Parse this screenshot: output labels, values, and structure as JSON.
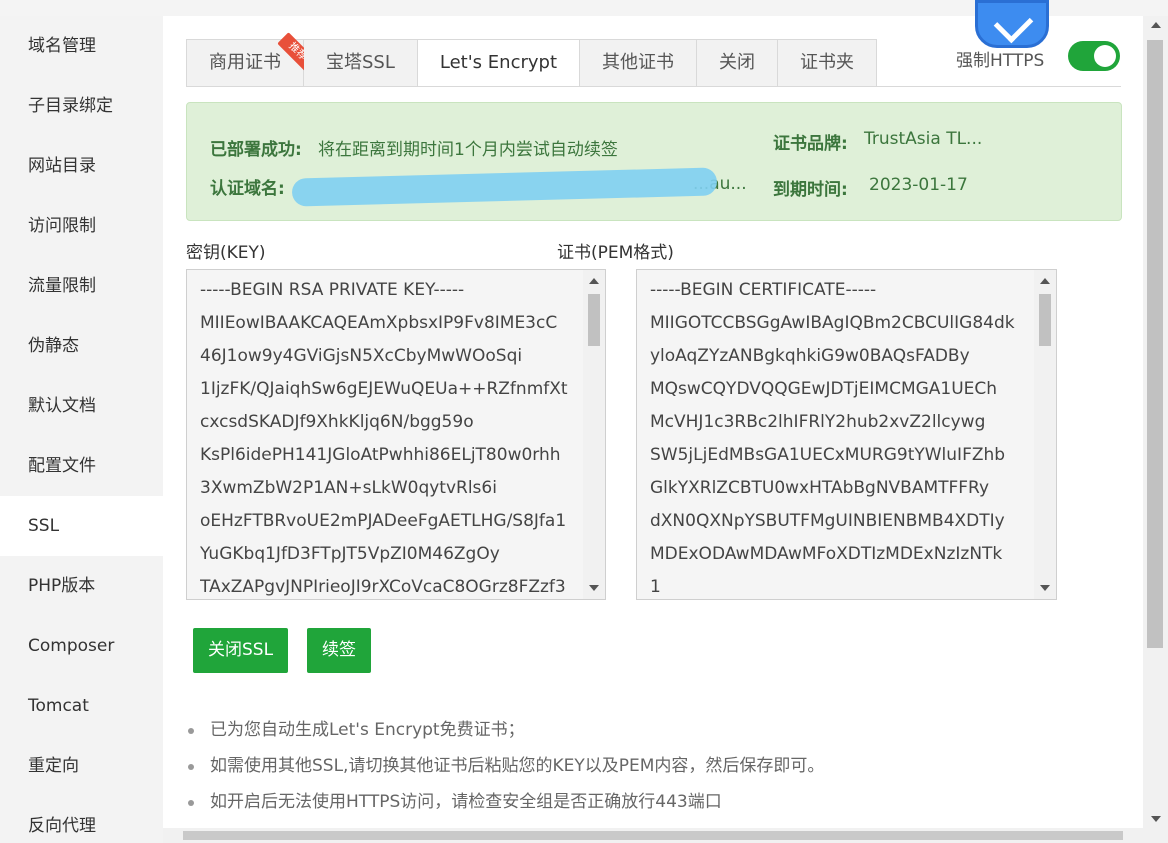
{
  "sidebar": {
    "items": [
      {
        "label": "域名管理"
      },
      {
        "label": "子目录绑定"
      },
      {
        "label": "网站目录"
      },
      {
        "label": "访问限制"
      },
      {
        "label": "流量限制"
      },
      {
        "label": "伪静态"
      },
      {
        "label": "默认文档"
      },
      {
        "label": "配置文件"
      },
      {
        "label": "SSL",
        "active": true
      },
      {
        "label": "PHP版本"
      },
      {
        "label": "Composer"
      },
      {
        "label": "Tomcat"
      },
      {
        "label": "重定向"
      },
      {
        "label": "反向代理"
      }
    ]
  },
  "tabs": [
    {
      "label": "商用证书",
      "badge": "推荐"
    },
    {
      "label": "宝塔SSL"
    },
    {
      "label": "Let's Encrypt",
      "active": true
    },
    {
      "label": "其他证书"
    },
    {
      "label": "关闭"
    },
    {
      "label": "证书夹"
    }
  ],
  "force_https": {
    "label": "强制HTTPS",
    "enabled": true
  },
  "status": {
    "deployed_label": "已部署成功:",
    "deployed_text": "将在距离到期时间1个月内尝试自动续签",
    "domain_label": "认证域名:",
    "domain_text": "...au...",
    "brand_label": "证书品牌:",
    "brand_text": "TrustAsia TL...",
    "expiry_label": "到期时间:",
    "expiry_text": "2023-01-17"
  },
  "key": {
    "label": "密钥(KEY)",
    "lines": [
      "-----BEGIN RSA PRIVATE KEY-----",
      "MIIEowIBAAKCAQEAmXpbsxIP9Fv8IME3cC",
      "46J1ow9y4GViGjsN5XcCbyMwWOoSqi",
      "1IjzFK/QJaiqhSw6gEJEWuQEUa++RZfnmfXt",
      "cxcsdSKADJf9XhkKljq6N/bgg59o",
      "KsPl6idePH141JGloAtPwhhi86ELjT80w0rhh",
      "3XwmZbW2P1AN+sLkW0qytvRls6i",
      "oEHzFTBRvoUE2mPJADeeFgAETLHG/S8Jfa1",
      "YuGKbq1JfD3FTpJT5VpZI0M46ZgOy",
      "TAxZAPgvJNPIrieoJI9rXCoVcaC8OGrz8FZzf3"
    ]
  },
  "cert": {
    "label": "证书(PEM格式)",
    "lines": [
      "-----BEGIN CERTIFICATE-----",
      "MIIGOTCCBSGgAwIBAgIQBm2CBCUlIG84dk",
      "yloAqZYzANBgkqhkiG9w0BAQsFADBy",
      "MQswCQYDVQQGEwJDTjEIMCMGA1UECh",
      "McVHJ1c3RBc2lhIFRlY2hub2xvZ2llcywg",
      "SW5jLjEdMBsGA1UECxMURG9tYWluIFZhb",
      "GlkYXRlZCBTU0wxHTAbBgNVBAMTFFRy",
      "dXN0QXNpYSBUTFMgUINBIENBMB4XDTIy",
      "MDExODAwMDAwMFoXDTIzMDExNzIzNTk",
      "1"
    ]
  },
  "buttons": {
    "close_ssl": "关闭SSL",
    "renew": "续签"
  },
  "tips": [
    "已为您自动生成Let's Encrypt免费证书；",
    "如需使用其他SSL,请切换其他证书后粘贴您的KEY以及PEM内容，然后保存即可。",
    "如开启后无法使用HTTPS访问，请检查安全组是否正确放行443端口"
  ],
  "colors": {
    "accent": "#20a53a",
    "success_bg": "#dff0d8",
    "success_text": "#3c763d"
  }
}
